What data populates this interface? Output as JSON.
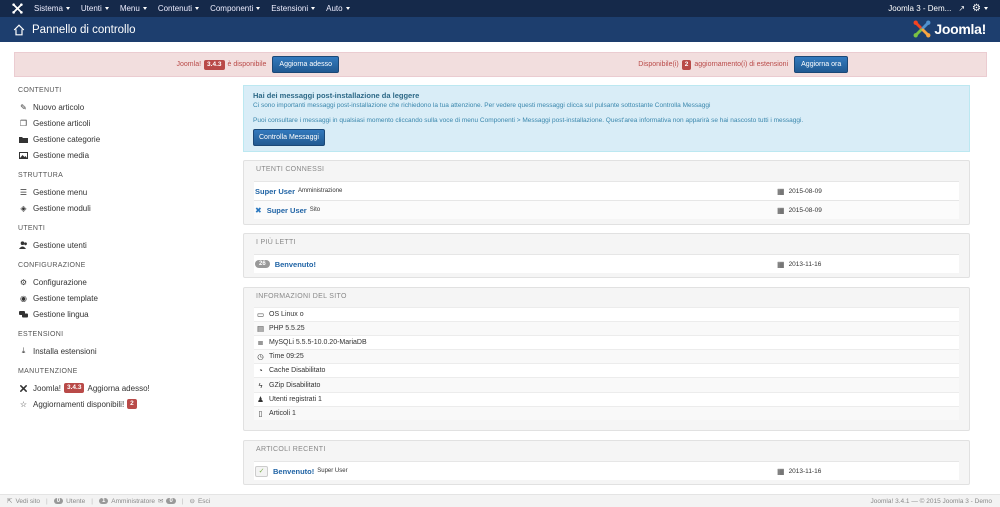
{
  "colors": {
    "topnav": "#15294a",
    "header": "#1d3e6e",
    "button": "#2a67a5",
    "badge": "#b94a48",
    "link": "#1f63a5",
    "alert_bg": "#f2dede",
    "info_bg": "#d9edf7"
  },
  "topnav": {
    "menus": [
      "Sistema",
      "Utenti",
      "Menu",
      "Contenuti",
      "Componenti",
      "Estensioni",
      "Auto"
    ],
    "site_name": "Joomla 3 - Dem...",
    "icons": {
      "logo": "joomla-icon",
      "external": "external-link-icon",
      "settings": "gear-icon"
    }
  },
  "header": {
    "title": "Pannello di controllo",
    "logo_text": "Joomla!"
  },
  "alert": {
    "left_prefix": "Joomla!",
    "left_version": "3.4.3",
    "left_suffix": "è disponibile",
    "left_button": "Aggiorna adesso",
    "right_prefix": "Disponibile(i)",
    "right_count": "2",
    "right_suffix": "aggiornamento(i) di estensioni",
    "right_button": "Aggiorna ora"
  },
  "sidebar": {
    "sections": [
      {
        "title": "CONTENUTI",
        "items": [
          {
            "label": "Nuovo articolo",
            "icon": "pencil-icon"
          },
          {
            "label": "Gestione articoli",
            "icon": "copy-icon"
          },
          {
            "label": "Gestione categorie",
            "icon": "folder-icon"
          },
          {
            "label": "Gestione media",
            "icon": "image-icon"
          }
        ]
      },
      {
        "title": "STRUTTURA",
        "items": [
          {
            "label": "Gestione menu",
            "icon": "list-icon"
          },
          {
            "label": "Gestione moduli",
            "icon": "cube-icon"
          }
        ]
      },
      {
        "title": "UTENTI",
        "items": [
          {
            "label": "Gestione utenti",
            "icon": "users-icon"
          }
        ]
      },
      {
        "title": "CONFIGURAZIONE",
        "items": [
          {
            "label": "Configurazione",
            "icon": "gear-icon"
          },
          {
            "label": "Gestione template",
            "icon": "eye-icon"
          },
          {
            "label": "Gestione lingua",
            "icon": "comments-icon"
          }
        ]
      },
      {
        "title": "ESTENSIONI",
        "items": [
          {
            "label": "Installa estensioni",
            "icon": "download-icon"
          }
        ]
      },
      {
        "title": "MANUTENZIONE",
        "items": [
          {
            "prefix": "Joomla!",
            "badge": "3.4.3",
            "label": "Aggiorna adesso!",
            "icon": "joomla-icon"
          },
          {
            "label": "Aggiornamenti disponibili!",
            "badge": "2",
            "icon": "star-icon"
          }
        ]
      }
    ]
  },
  "postinstall": {
    "title": "Hai dei messaggi post-installazione da leggere",
    "text1": "Ci sono importanti messaggi post-installazione che richiedono la tua attenzione. Per vedere questi messaggi clicca sul pulsante sottostante Controlla Messaggi",
    "text2": "Puoi consultare i messaggi in qualsiasi momento cliccando sulla voce di menu Componenti > Messaggi post-installazione. Quest'area informativa non apparirà se hai nascosto tutti i messaggi.",
    "button": "Controlla Messaggi"
  },
  "logged_users": {
    "title": "UTENTI CONNESSI",
    "rows": [
      {
        "name": "Super User",
        "area": "Amministrazione",
        "date": "2015-08-09"
      },
      {
        "name": "Super User",
        "area": "Sito",
        "date": "2015-08-09"
      }
    ]
  },
  "popular": {
    "title": "I PIÙ LETTI",
    "rows": [
      {
        "hits": "26",
        "title": "Benvenuto!",
        "date": "2013-11-16"
      }
    ]
  },
  "site_info": {
    "title": "INFORMAZIONI DEL SITO",
    "rows": [
      {
        "label": "OS Linux o",
        "icon": "monitor-icon"
      },
      {
        "label": "PHP 5.5.25",
        "icon": "php-icon"
      },
      {
        "label": "MySQLi 5.5.5-10.0.20-MariaDB",
        "icon": "database-icon"
      },
      {
        "label": "Time 09:25",
        "icon": "clock-icon"
      },
      {
        "label": "Cache Disabilitato",
        "icon": "dashboard-icon"
      },
      {
        "label": "GZip Disabilitato",
        "icon": "lightning-icon"
      },
      {
        "label": "Utenti registrati 1",
        "icon": "user-icon"
      },
      {
        "label": "Articoli 1",
        "icon": "file-icon"
      }
    ]
  },
  "recent": {
    "title": "ARTICOLI RECENTI",
    "rows": [
      {
        "title": "Benvenuto!",
        "author": "Super User",
        "date": "2013-11-16"
      }
    ]
  },
  "footer": {
    "view_site": "Vedi sito",
    "visitors_count": "0",
    "visitors_label": "Utente",
    "admins_count": "1",
    "admins_label": "Amministratore",
    "messages_count": "0",
    "logout": "Esci",
    "copyright": "Joomla! 3.4.1 — © 2015 Joomla 3 - Demo"
  }
}
